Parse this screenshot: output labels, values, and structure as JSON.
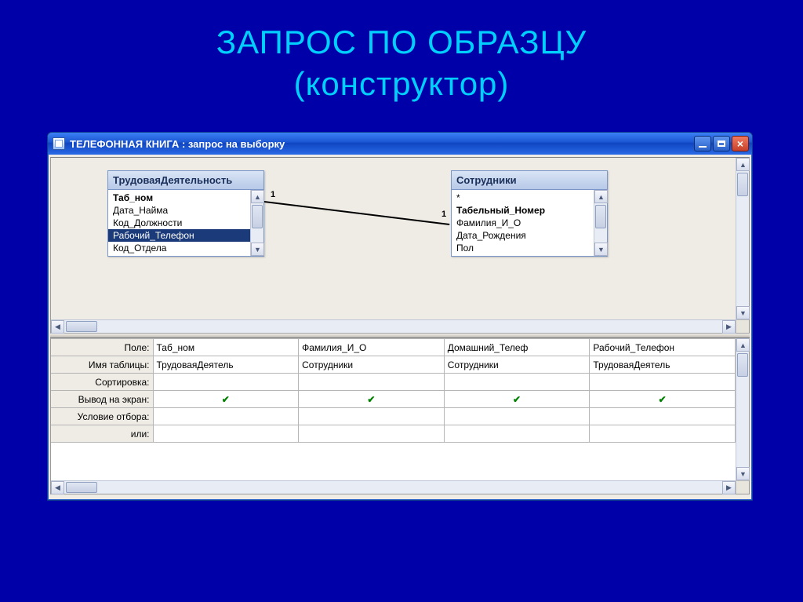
{
  "slide": {
    "title_line1": "ЗАПРОС ПО ОБРАЗЦУ",
    "title_line2": "(конструктор)"
  },
  "window": {
    "title": "ТЕЛЕФОННАЯ КНИГА : запрос на выборку"
  },
  "tables": {
    "left": {
      "name": "ТрудоваяДеятельность",
      "fields": [
        "Таб_ном",
        "Дата_Найма",
        "Код_Должности",
        "Рабочий_Телефон",
        "Код_Отдела"
      ],
      "bold_index": 0,
      "selected_index": 3
    },
    "right": {
      "name": "Сотрудники",
      "fields": [
        "*",
        "Табельный_Номер",
        "Фамилия_И_О",
        "Дата_Рождения",
        "Пол"
      ],
      "bold_index": 1,
      "selected_index": -1
    }
  },
  "relation": {
    "left_card": "1",
    "right_card": "1"
  },
  "qbe": {
    "row_labels": [
      "Поле:",
      "Имя таблицы:",
      "Сортировка:",
      "Вывод на экран:",
      "Условие отбора:",
      "или:"
    ],
    "columns": [
      {
        "field": "Таб_ном",
        "table": "ТрудоваяДеятель",
        "sort": "",
        "show": true,
        "crit": "",
        "or": ""
      },
      {
        "field": "Фамилия_И_О",
        "table": "Сотрудники",
        "sort": "",
        "show": true,
        "crit": "",
        "or": ""
      },
      {
        "field": "Домашний_Телеф",
        "table": "Сотрудники",
        "sort": "",
        "show": true,
        "crit": "",
        "or": ""
      },
      {
        "field": "Рабочий_Телефон",
        "table": "ТрудоваяДеятель",
        "sort": "",
        "show": true,
        "crit": "",
        "or": ""
      }
    ]
  }
}
